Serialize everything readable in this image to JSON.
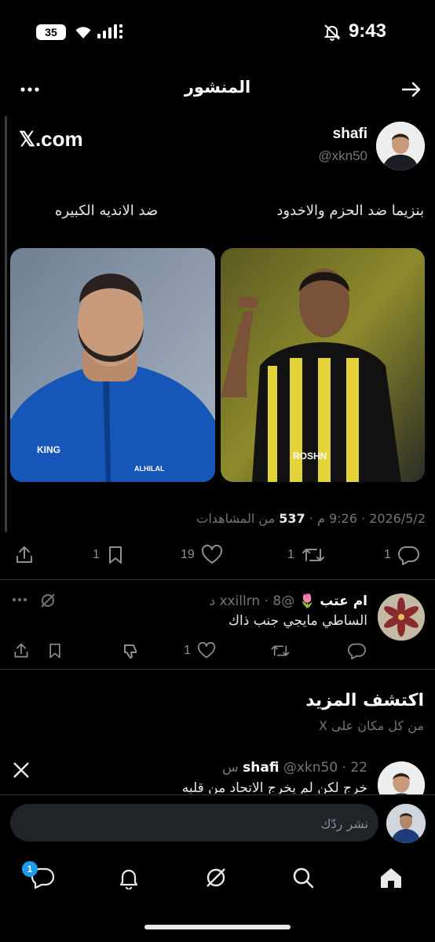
{
  "status_bar": {
    "time": "9:43",
    "battery": "35",
    "icons": [
      "wifi-icon",
      "signal-icon",
      "bell-muted-icon"
    ]
  },
  "header": {
    "title": "المنشور",
    "back_icon": "arrow-right-icon",
    "more_icon": "more-horizontal-icon"
  },
  "post": {
    "source_label": "𝕏.com",
    "author_name": "shafi",
    "author_handle": "@xkn50",
    "caption_right": "بنزيما ضد الحزم والاخدود",
    "caption_left": "ضد الانديه الكبيره",
    "image_left_alt": "Benzema in blue Al Hilal jacket",
    "image_right_alt": "Hamdallah in Al Ittihad shirt",
    "jersey_text": [
      "KING",
      "ALHILAL",
      "ROSHN"
    ],
    "date": "2026/5/2",
    "time": "9:26 م",
    "views_count": "537",
    "views_label": "من المشاهدات",
    "actions": {
      "share_icon": "share-icon",
      "bookmarks": "1",
      "likes": "19",
      "reposts": "1",
      "replies": "1"
    }
  },
  "reply": {
    "author_name": "ام عتب",
    "emoji": "🌷",
    "handle": "@xxillrn",
    "age": "8 د",
    "text": "الساطي مايجي جنب ذاك",
    "actions": {
      "likes": "1"
    }
  },
  "discover": {
    "title": "اكتشف المزيد",
    "subtitle": "من كل مكان على X"
  },
  "recommended": {
    "author_name": "shafi",
    "handle": "@xkn50",
    "age": "22 س",
    "text": "خرج لكن لم يخرج الاتحاد من قلبه"
  },
  "composer": {
    "placeholder": "نشر ردّك"
  },
  "nav": {
    "items": [
      "home-icon",
      "search-icon",
      "grok-icon",
      "notifications-icon",
      "messages-icon"
    ],
    "messages_badge": "1"
  },
  "colors": {
    "background": "#000000",
    "text": "#e7e9ea",
    "muted": "#71767b",
    "accent": "#1d9bf0",
    "divider": "#2f3336"
  }
}
